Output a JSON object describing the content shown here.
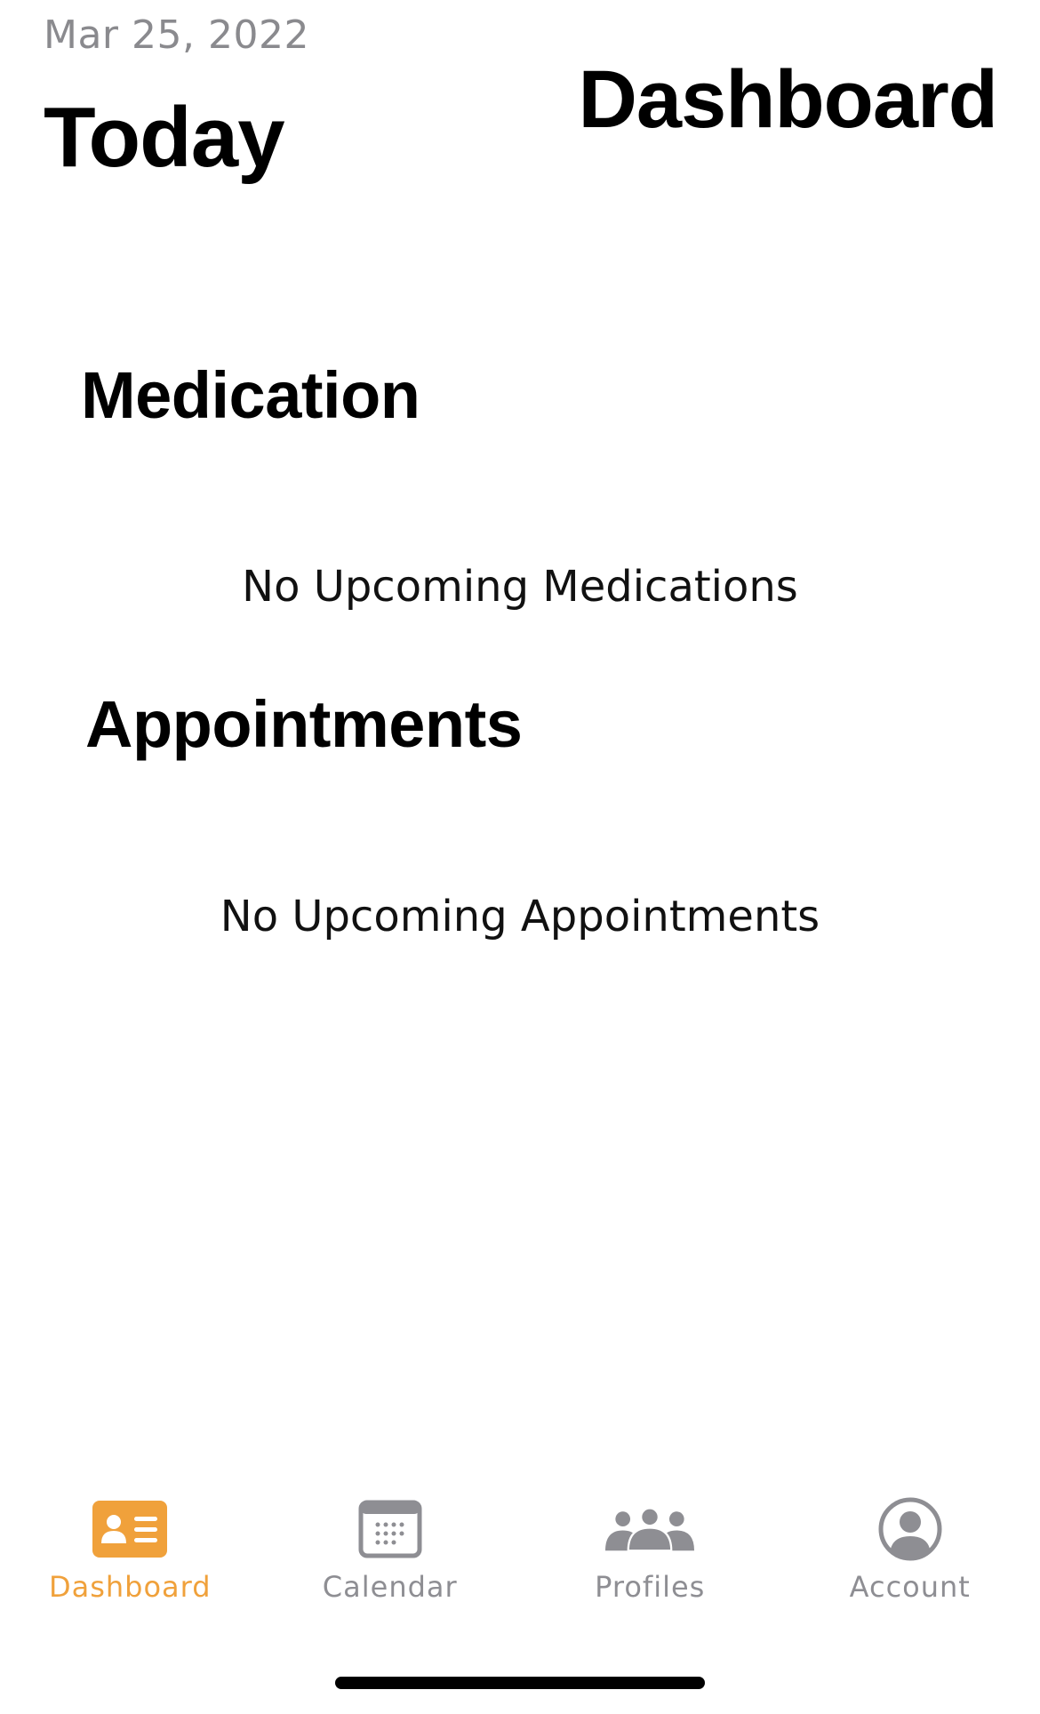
{
  "header": {
    "date": "Mar 25, 2022",
    "today_label": "Today",
    "page_title": "Dashboard"
  },
  "sections": {
    "medication": {
      "title": "Medication",
      "empty_message": "No Upcoming Medications"
    },
    "appointments": {
      "title": "Appointments",
      "empty_message": "No Upcoming Appointments"
    }
  },
  "tab_bar": {
    "active_color": "#f0a13b",
    "inactive_color": "#8e8e93",
    "tabs": [
      {
        "label": "Dashboard",
        "icon": "person-card-icon",
        "active": true
      },
      {
        "label": "Calendar",
        "icon": "calendar-icon",
        "active": false
      },
      {
        "label": "Profiles",
        "icon": "people-icon",
        "active": false
      },
      {
        "label": "Account",
        "icon": "account-circle-icon",
        "active": false
      }
    ]
  }
}
